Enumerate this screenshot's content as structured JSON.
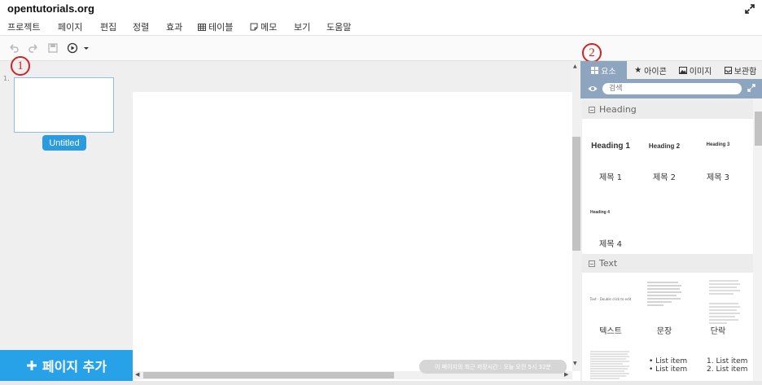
{
  "app": {
    "title": "opentutorials.org"
  },
  "menu": {
    "items": [
      {
        "label": "프로젝트"
      },
      {
        "label": "페이지"
      },
      {
        "label": "편집"
      },
      {
        "label": "정렬"
      },
      {
        "label": "효과"
      },
      {
        "label": "테이블",
        "icon": "table-icon"
      },
      {
        "label": "메모",
        "icon": "memo-icon"
      },
      {
        "label": "보기"
      },
      {
        "label": "도움말"
      }
    ]
  },
  "toolbar": {
    "icons": [
      "undo-icon",
      "redo-icon",
      "save-icon",
      "play-icon",
      "dropdown-arrow-icon"
    ]
  },
  "annotations": {
    "marker1": "1",
    "marker2": "2"
  },
  "pages": {
    "items": [
      {
        "number": "1.",
        "name": "Untitled"
      }
    ],
    "add_label": "페이지 추가"
  },
  "status": {
    "message": "이 페이지의 최근 저장시간 : 오늘 오전 5시 32분"
  },
  "panel": {
    "tabs": [
      {
        "label": "요소",
        "icon": "grid-icon",
        "active": true
      },
      {
        "label": "아이콘",
        "icon": "star-icon",
        "active": false
      },
      {
        "label": "이미지",
        "icon": "image-icon",
        "active": false
      },
      {
        "label": "보관함",
        "icon": "archive-icon",
        "active": false
      }
    ],
    "search_placeholder": "검색",
    "sections": [
      {
        "title": "Heading",
        "items": [
          {
            "preview": "Heading 1",
            "label": "제목 1"
          },
          {
            "preview": "Heading 2",
            "label": "제목 2"
          },
          {
            "preview": "Heading 3",
            "label": "제목 3"
          },
          {
            "preview": "Heading 4",
            "label": "제목 4"
          }
        ]
      },
      {
        "title": "Text",
        "items": [
          {
            "preview": "Text - Double click to edit",
            "label": "텍스트"
          },
          {
            "preview": "",
            "label": "문장"
          },
          {
            "preview": "",
            "label": "단락"
          }
        ]
      }
    ],
    "lists": {
      "bulleted": [
        "List item",
        "List item"
      ],
      "numbered": [
        "1. List item",
        "2. List item"
      ]
    }
  },
  "colors": {
    "accent": "#27a1e8",
    "panel_header": "#8ea5bf",
    "annotation": "#d42222"
  }
}
